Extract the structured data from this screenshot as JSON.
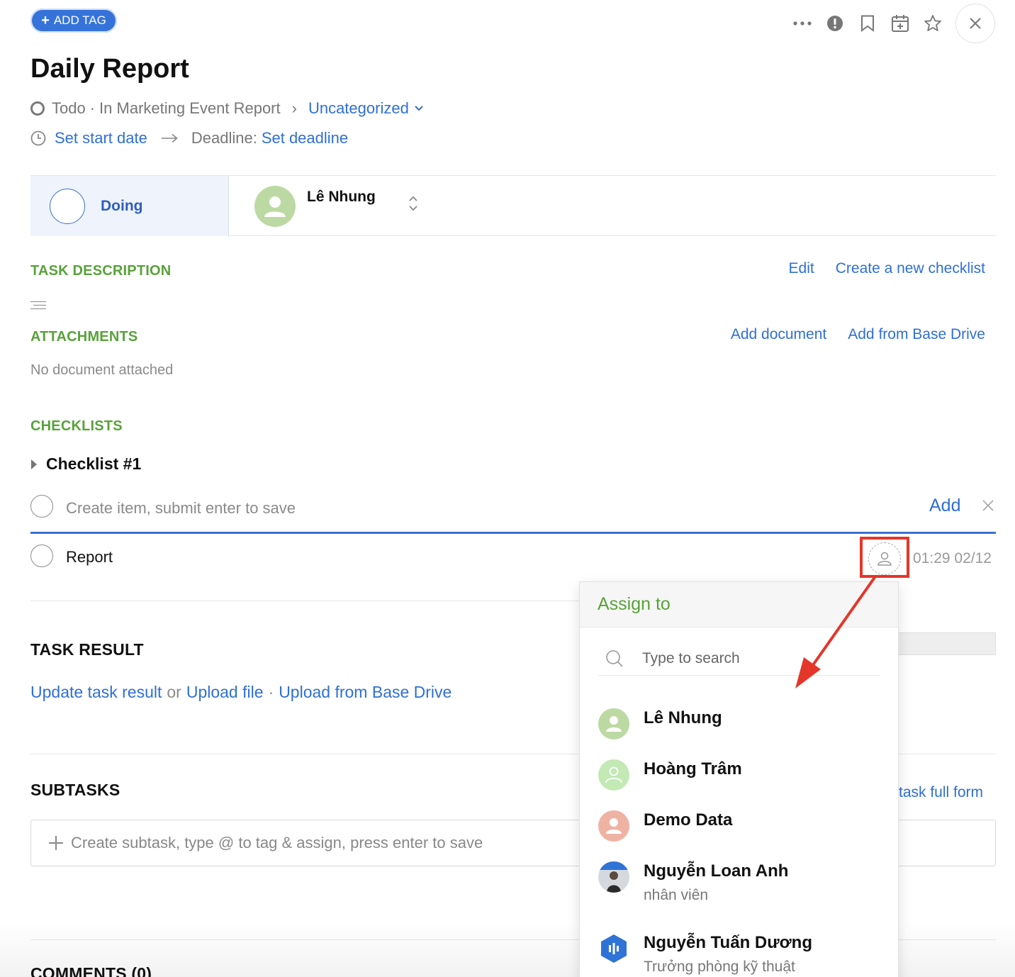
{
  "toolbar": {
    "add_tag_label": "ADD TAG"
  },
  "task": {
    "title": "Daily Report",
    "status_word": "Todo",
    "breadcrumb_sep": "·",
    "project": "In Marketing Event Report",
    "category": "Uncategorized",
    "start_date_label": "Set start date",
    "deadline_label": "Deadline:",
    "deadline_value": "Set deadline"
  },
  "status_bar": {
    "status_label": "Doing",
    "assignee_name": "Lê Nhung"
  },
  "description": {
    "heading": "TASK DESCRIPTION",
    "edit_link": "Edit",
    "checklist_link": "Create a new checklist"
  },
  "attachments": {
    "heading": "ATTACHMENTS",
    "add_document": "Add document",
    "add_from_drive": "Add from Base Drive",
    "empty_text": "No document attached"
  },
  "checklists": {
    "heading": "CHECKLISTS",
    "checklist_name": "Checklist #1",
    "new_item_placeholder": "Create item, submit enter to save",
    "add_button": "Add",
    "items": [
      {
        "label": "Report",
        "timestamp": "01:29 02/12"
      }
    ]
  },
  "task_result": {
    "heading": "TASK RESULT",
    "update_link": "Update task result",
    "or_text": "or",
    "upload_link": "Upload file",
    "sep": "·",
    "drive_link": "Upload from Base Drive"
  },
  "subtasks": {
    "heading": "SUBTASKS",
    "full_form_link_partial": "task full form",
    "input_placeholder": "Create subtask, type @ to tag & assign, press enter to save"
  },
  "comments": {
    "heading_partial": "COMMENTS (0)"
  },
  "assign_dropdown": {
    "heading": "Assign to",
    "search_placeholder": "Type to search",
    "users": [
      {
        "name": "Lê Nhung",
        "subtitle": "",
        "avatar_color": "#bdd9a3"
      },
      {
        "name": "Hoàng Trâm",
        "subtitle": "",
        "avatar_color": "#c3e9b5"
      },
      {
        "name": "Demo Data",
        "subtitle": "",
        "avatar_color": "#efb3a3"
      },
      {
        "name": "Nguyễn Loan Anh",
        "subtitle": "nhân viên",
        "avatar_color": "#9aa3ad"
      },
      {
        "name": "Nguyễn Tuấn Dương",
        "subtitle": "Trưởng phòng kỹ thuật",
        "avatar_color": "#2f73d6"
      }
    ]
  },
  "colors": {
    "accent_blue": "#2f6fd6",
    "section_green": "#58a23a",
    "highlight_red": "#e5362a"
  }
}
